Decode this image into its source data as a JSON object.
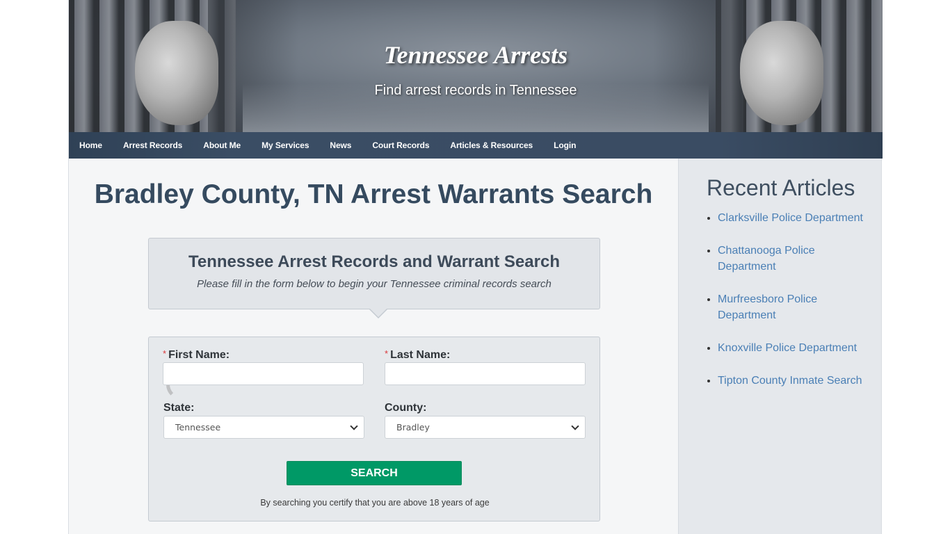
{
  "header": {
    "site_title": "Tennessee Arrests",
    "tagline": "Find arrest records in Tennessee"
  },
  "nav": {
    "items": [
      {
        "label": "Home"
      },
      {
        "label": "Arrest Records"
      },
      {
        "label": "About Me"
      },
      {
        "label": "My Services"
      },
      {
        "label": "News"
      },
      {
        "label": "Court Records"
      },
      {
        "label": "Articles & Resources"
      },
      {
        "label": "Login"
      }
    ]
  },
  "main": {
    "page_title": "Bradley County, TN Arrest Warrants Search",
    "intro": {
      "heading": "Tennessee Arrest Records and Warrant Search",
      "subtext": "Please fill in the form below to begin your Tennessee criminal records search"
    },
    "form": {
      "required_marker": "*",
      "first_name_label": "First Name:",
      "first_name_value": "",
      "last_name_label": "Last Name:",
      "last_name_value": "",
      "state_label": "State:",
      "state_value": "Tennessee",
      "county_label": "County:",
      "county_value": "Bradley",
      "search_label": "SEARCH",
      "disclaimer": "By searching you certify that you are above 18 years of age"
    }
  },
  "sidebar": {
    "heading": "Recent Articles",
    "articles": [
      {
        "label": "Clarksville Police Department"
      },
      {
        "label": "Chattanooga Police Department"
      },
      {
        "label": "Murfreesboro Police Department"
      },
      {
        "label": "Knoxville Police Department"
      },
      {
        "label": "Tipton County Inmate Search"
      }
    ]
  },
  "colors": {
    "nav_bg": "#3a4c63",
    "title_text": "#354a5f",
    "search_button": "#009966",
    "link": "#4a7fb5",
    "required": "#d9383a"
  }
}
